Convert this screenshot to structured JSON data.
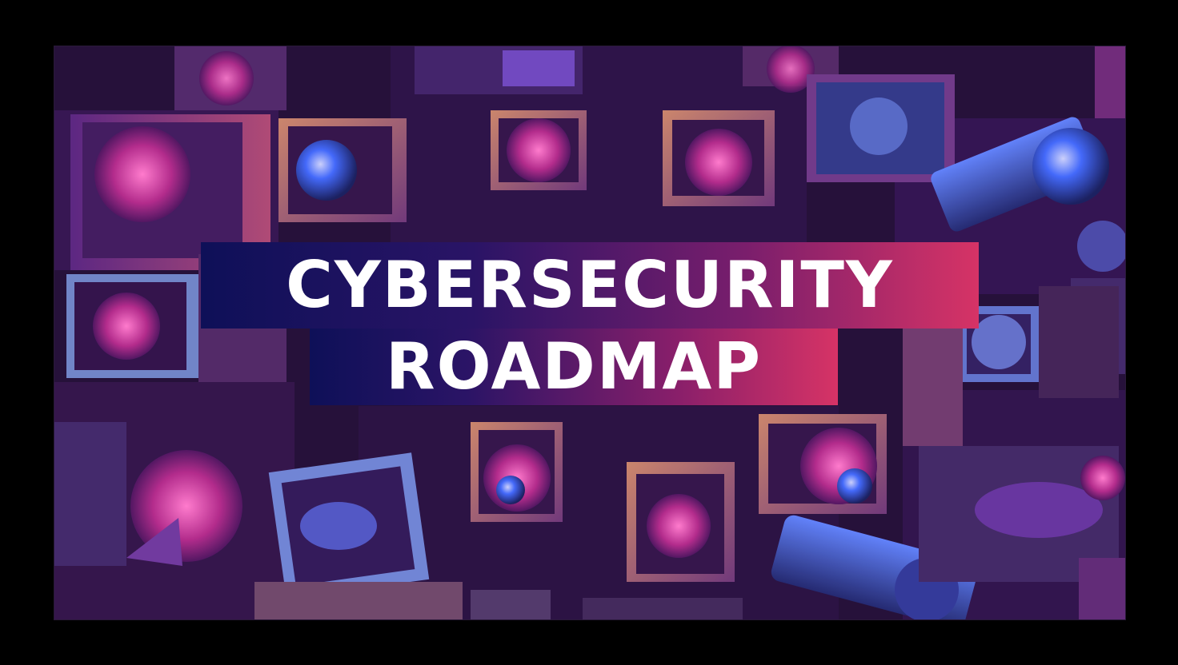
{
  "title": {
    "line1": "CYBERSECURITY",
    "line2": "ROADMAP"
  },
  "colors": {
    "banner_start": "#0e1058",
    "banner_end": "#d63366",
    "title_text": "#ffffff",
    "frame": "#000000"
  }
}
